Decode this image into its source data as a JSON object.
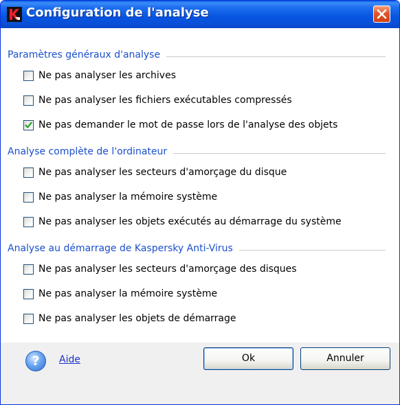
{
  "window": {
    "title": "Configuration de l'analyse",
    "app_icon": "kaspersky-k-icon",
    "close_icon": "close-icon"
  },
  "sections": [
    {
      "title": "Paramètres généraux d'analyse",
      "options": [
        {
          "label": "Ne pas analyser les archives",
          "checked": false
        },
        {
          "label": "Ne pas analyser les fichiers exécutables compressés",
          "checked": false
        },
        {
          "label": "Ne pas demander le mot de passe lors de l'analyse des objets",
          "checked": true
        }
      ]
    },
    {
      "title": "Analyse complète de l'ordinateur",
      "options": [
        {
          "label": "Ne pas analyser les secteurs d'amorçage du disque",
          "checked": false
        },
        {
          "label": "Ne pas analyser la mémoire système",
          "checked": false
        },
        {
          "label": "Ne pas analyser les objets exécutés au démarrage du système",
          "checked": false
        }
      ]
    },
    {
      "title": "Analyse au démarrage de Kaspersky Anti-Virus",
      "options": [
        {
          "label": "Ne pas analyser les secteurs d'amorçage des disques",
          "checked": false
        },
        {
          "label": "Ne pas analyser la mémoire système",
          "checked": false
        },
        {
          "label": "Ne pas analyser les objets de démarrage",
          "checked": false
        }
      ]
    }
  ],
  "footer": {
    "help_icon_glyph": "?",
    "help_label": "Aide",
    "ok_label": "Ok",
    "cancel_label": "Annuler"
  },
  "colors": {
    "title_bar": "#0754e0",
    "section_title": "#1b4fcb",
    "link": "#1c2ecb",
    "check": "#21a121"
  }
}
